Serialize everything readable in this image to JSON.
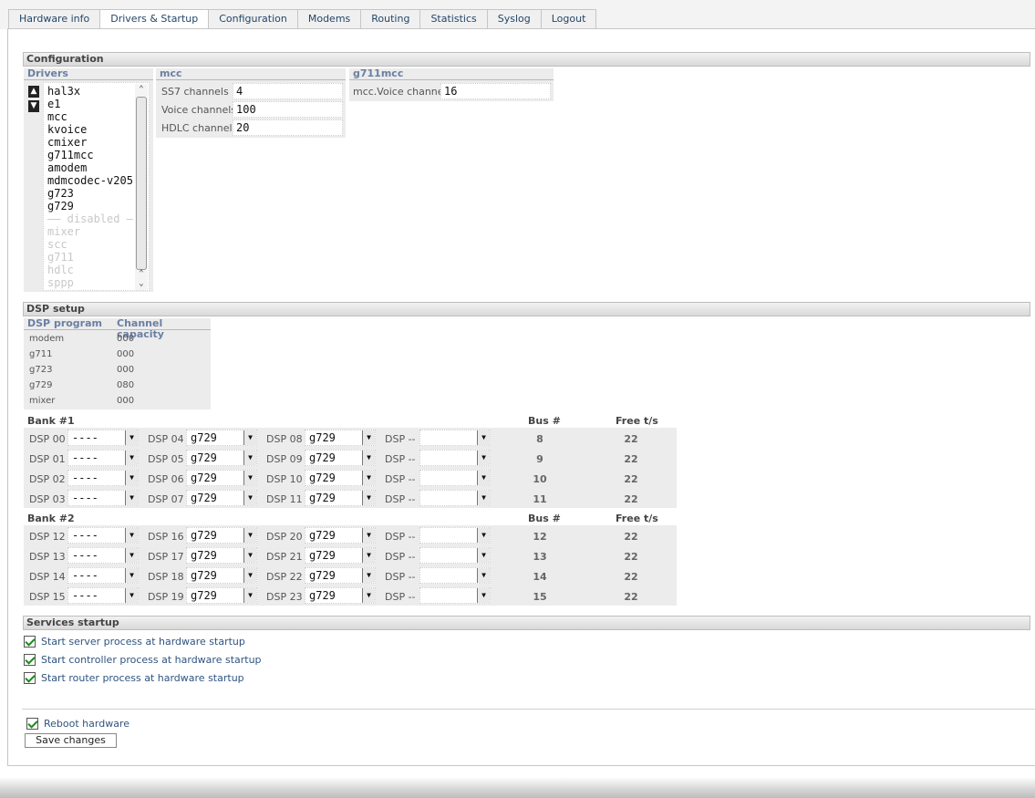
{
  "tabs": [
    "Hardware info",
    "Drivers & Startup",
    "Configuration",
    "Modems",
    "Routing",
    "Statistics",
    "Syslog",
    "Logout"
  ],
  "active_tab": "Drivers & Startup",
  "configuration": {
    "title": "Configuration",
    "drivers_header": "Drivers",
    "drivers": [
      "hal3x",
      "e1",
      "mcc",
      "kvoice",
      "cmixer",
      "g711mcc",
      "amodem",
      "mdmcodec-v205",
      "g723",
      "g729"
    ],
    "disabled_separator": "—— disabled —",
    "disabled_drivers": [
      "mixer",
      "scc",
      "g711",
      "hdlc",
      "sppp"
    ],
    "mcc": {
      "header": "mcc",
      "fields": [
        {
          "label": "SS7 channels",
          "value": "4"
        },
        {
          "label": "Voice channels",
          "value": "100"
        },
        {
          "label": "HDLC channels",
          "value": "20"
        }
      ]
    },
    "g711mcc": {
      "header": "g711mcc",
      "fields": [
        {
          "label": "mcc.Voice channels",
          "value": "16"
        }
      ]
    }
  },
  "dsp_setup": {
    "title": "DSP setup",
    "col_program": "DSP program",
    "col_capacity": "Channel capacity",
    "programs": [
      {
        "name": "modem",
        "capacity": "000"
      },
      {
        "name": "g711",
        "capacity": "000"
      },
      {
        "name": "g723",
        "capacity": "000"
      },
      {
        "name": "g729",
        "capacity": "080"
      },
      {
        "name": "mixer",
        "capacity": "000"
      }
    ],
    "bus_header": "Bus #",
    "free_header": "Free t/s",
    "banks": [
      {
        "title": "Bank #1",
        "rows": [
          {
            "dsps": [
              {
                "label": "DSP 00",
                "value": "----"
              },
              {
                "label": "DSP 04",
                "value": "g729"
              },
              {
                "label": "DSP 08",
                "value": "g729"
              },
              {
                "label": "DSP --",
                "value": ""
              }
            ],
            "bus": "8",
            "free": "22"
          },
          {
            "dsps": [
              {
                "label": "DSP 01",
                "value": "----"
              },
              {
                "label": "DSP 05",
                "value": "g729"
              },
              {
                "label": "DSP 09",
                "value": "g729"
              },
              {
                "label": "DSP --",
                "value": ""
              }
            ],
            "bus": "9",
            "free": "22"
          },
          {
            "dsps": [
              {
                "label": "DSP 02",
                "value": "----"
              },
              {
                "label": "DSP 06",
                "value": "g729"
              },
              {
                "label": "DSP 10",
                "value": "g729"
              },
              {
                "label": "DSP --",
                "value": ""
              }
            ],
            "bus": "10",
            "free": "22"
          },
          {
            "dsps": [
              {
                "label": "DSP 03",
                "value": "----"
              },
              {
                "label": "DSP 07",
                "value": "g729"
              },
              {
                "label": "DSP 11",
                "value": "g729"
              },
              {
                "label": "DSP --",
                "value": ""
              }
            ],
            "bus": "11",
            "free": "22"
          }
        ]
      },
      {
        "title": "Bank #2",
        "rows": [
          {
            "dsps": [
              {
                "label": "DSP 12",
                "value": "----"
              },
              {
                "label": "DSP 16",
                "value": "g729"
              },
              {
                "label": "DSP 20",
                "value": "g729"
              },
              {
                "label": "DSP --",
                "value": ""
              }
            ],
            "bus": "12",
            "free": "22"
          },
          {
            "dsps": [
              {
                "label": "DSP 13",
                "value": "----"
              },
              {
                "label": "DSP 17",
                "value": "g729"
              },
              {
                "label": "DSP 21",
                "value": "g729"
              },
              {
                "label": "DSP --",
                "value": ""
              }
            ],
            "bus": "13",
            "free": "22"
          },
          {
            "dsps": [
              {
                "label": "DSP 14",
                "value": "----"
              },
              {
                "label": "DSP 18",
                "value": "g729"
              },
              {
                "label": "DSP 22",
                "value": "g729"
              },
              {
                "label": "DSP --",
                "value": ""
              }
            ],
            "bus": "14",
            "free": "22"
          },
          {
            "dsps": [
              {
                "label": "DSP 15",
                "value": "----"
              },
              {
                "label": "DSP 19",
                "value": "g729"
              },
              {
                "label": "DSP 23",
                "value": "g729"
              },
              {
                "label": "DSP --",
                "value": ""
              }
            ],
            "bus": "15",
            "free": "22"
          }
        ]
      }
    ]
  },
  "services": {
    "title": "Services startup",
    "items": [
      {
        "label": "Start server process at hardware startup",
        "checked": true
      },
      {
        "label": "Start controller process at hardware startup",
        "checked": true
      },
      {
        "label": "Start router process at hardware startup",
        "checked": true
      }
    ]
  },
  "reboot": {
    "label": "Reboot hardware",
    "checked": true
  },
  "save_button": "Save changes",
  "icons": {
    "move_up": "arrow-up-icon",
    "move_down": "arrow-down-icon",
    "dropdown": "dropdown-arrow-icon"
  }
}
